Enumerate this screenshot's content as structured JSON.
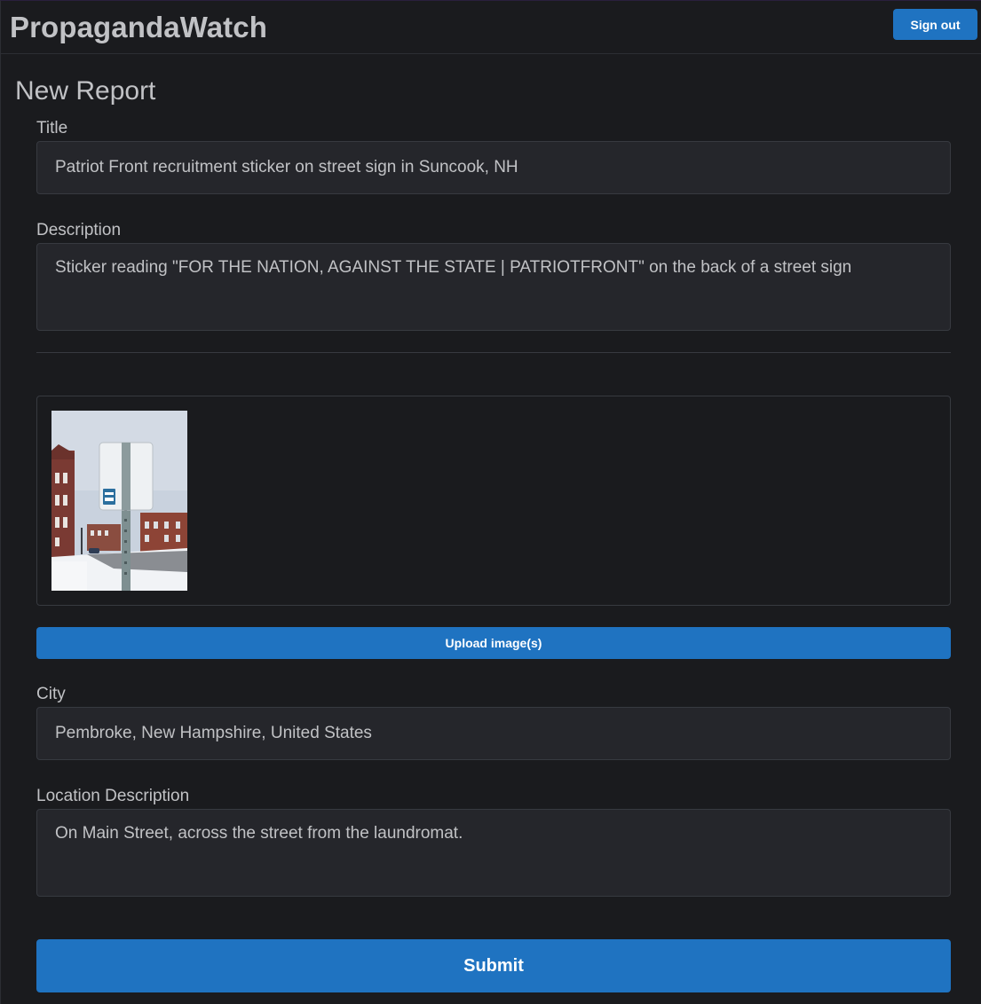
{
  "header": {
    "brand": "PropagandaWatch",
    "signout_label": "Sign out"
  },
  "page": {
    "title": "New Report"
  },
  "form": {
    "title_label": "Title",
    "title_value": "Patriot Front recruitment sticker on street sign in Suncook, NH",
    "description_label": "Description",
    "description_value": "Sticker reading \"FOR THE NATION, AGAINST THE STATE | PATRIOTFRONT\" on the back of a street sign",
    "upload_label": "Upload image(s)",
    "city_label": "City",
    "city_value": "Pembroke, New Hampshire, United States",
    "location_label": "Location Description",
    "location_value": "On Main Street, across the street from the laundromat.",
    "submit_label": "Submit"
  },
  "images": [
    {
      "subject": "street-sign-photo"
    }
  ],
  "colors": {
    "background": "#1a1b1e",
    "input_bg": "#25262b",
    "border": "#373a40",
    "accent": "#1f73c1",
    "text": "#c1c2c5"
  }
}
